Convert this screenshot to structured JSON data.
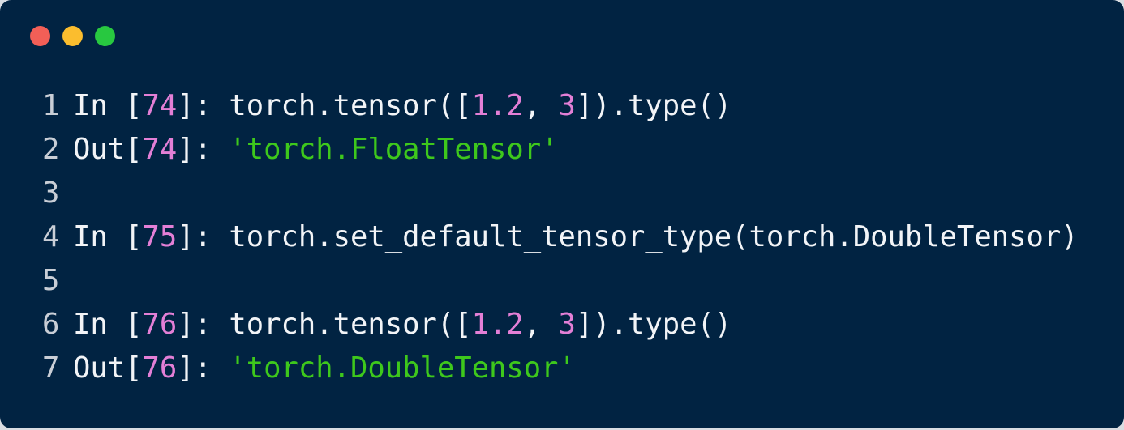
{
  "window": {
    "controls": [
      {
        "name": "close",
        "color": "#f25f57"
      },
      {
        "name": "minimize",
        "color": "#fbbd2e"
      },
      {
        "name": "maximize",
        "color": "#28c840"
      }
    ]
  },
  "colors": {
    "background": "#012342",
    "text": "#f2f4f7",
    "number": "#e37fd6",
    "string": "#3ec81c",
    "line_number": "#c9ced6"
  },
  "code": {
    "lines": [
      {
        "number": "1",
        "segments": [
          {
            "text": "In [",
            "type": "txt"
          },
          {
            "text": "74",
            "type": "num"
          },
          {
            "text": "]: torch.tensor([",
            "type": "txt"
          },
          {
            "text": "1.2",
            "type": "num"
          },
          {
            "text": ", ",
            "type": "txt"
          },
          {
            "text": "3",
            "type": "num"
          },
          {
            "text": "]).type()",
            "type": "txt"
          }
        ]
      },
      {
        "number": "2",
        "segments": [
          {
            "text": "Out[",
            "type": "txt"
          },
          {
            "text": "74",
            "type": "num"
          },
          {
            "text": "]: ",
            "type": "txt"
          },
          {
            "text": "'torch.FloatTensor'",
            "type": "str"
          }
        ]
      },
      {
        "number": "3",
        "segments": []
      },
      {
        "number": "4",
        "segments": [
          {
            "text": "In [",
            "type": "txt"
          },
          {
            "text": "75",
            "type": "num"
          },
          {
            "text": "]: torch.set_default_tensor_type(torch.DoubleTensor)",
            "type": "txt"
          }
        ]
      },
      {
        "number": "5",
        "segments": []
      },
      {
        "number": "6",
        "segments": [
          {
            "text": "In [",
            "type": "txt"
          },
          {
            "text": "76",
            "type": "num"
          },
          {
            "text": "]: torch.tensor([",
            "type": "txt"
          },
          {
            "text": "1.2",
            "type": "num"
          },
          {
            "text": ", ",
            "type": "txt"
          },
          {
            "text": "3",
            "type": "num"
          },
          {
            "text": "]).type()",
            "type": "txt"
          }
        ]
      },
      {
        "number": "7",
        "segments": [
          {
            "text": "Out[",
            "type": "txt"
          },
          {
            "text": "76",
            "type": "num"
          },
          {
            "text": "]: ",
            "type": "txt"
          },
          {
            "text": "'torch.DoubleTensor'",
            "type": "str"
          }
        ]
      }
    ]
  }
}
